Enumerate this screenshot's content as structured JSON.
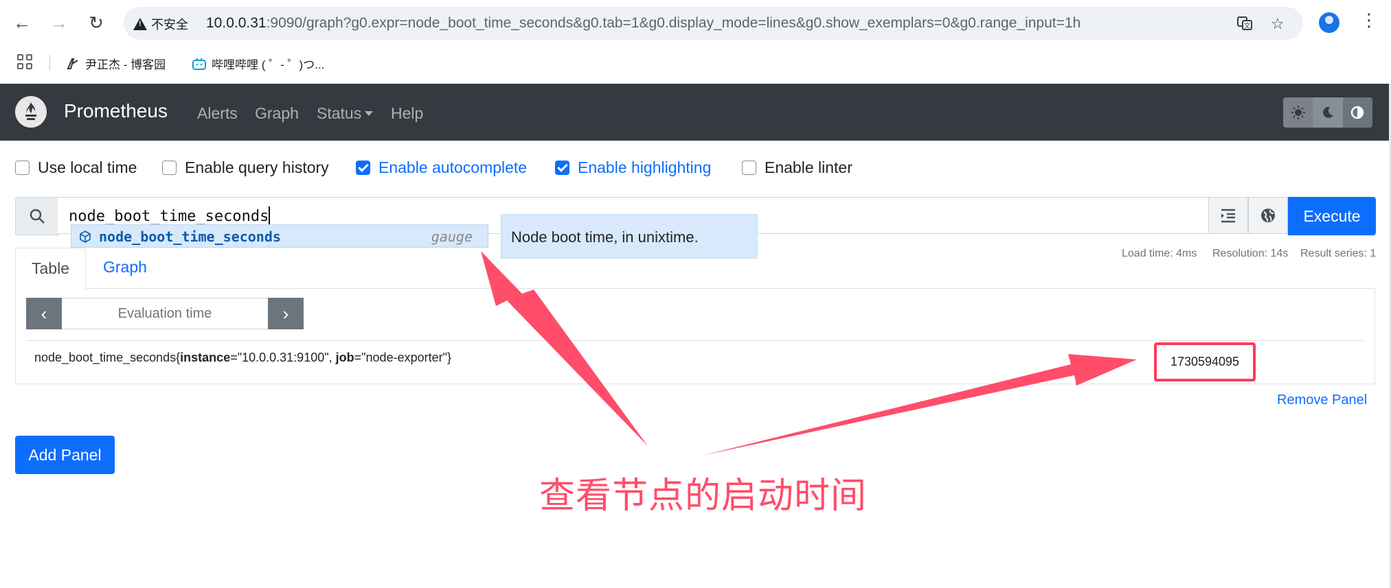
{
  "browser": {
    "security_label": "不安全",
    "url_host": "10.0.0.31",
    "url_rest": ":9090/graph?g0.expr=node_boot_time_seconds&g0.tab=1&g0.display_mode=lines&g0.show_exemplars=0&g0.range_input=1h",
    "bookmarks": [
      {
        "label": "尹正杰 - 博客园",
        "icon": "blog-icon"
      },
      {
        "label": "哔哩哔哩 ( ゜- ゜)つ...",
        "icon": "bilibili-icon"
      }
    ]
  },
  "navbar": {
    "brand": "Prometheus",
    "links": {
      "alerts": "Alerts",
      "graph": "Graph",
      "status": "Status",
      "help": "Help"
    }
  },
  "options": {
    "local_time": {
      "label": "Use local time",
      "checked": false
    },
    "query_history": {
      "label": "Enable query history",
      "checked": false
    },
    "autocomplete": {
      "label": "Enable autocomplete",
      "checked": true
    },
    "highlighting": {
      "label": "Enable highlighting",
      "checked": true
    },
    "linter": {
      "label": "Enable linter",
      "checked": false
    }
  },
  "query": {
    "expression": "node_boot_time_seconds",
    "execute_label": "Execute"
  },
  "autocomplete": {
    "name": "node_boot_time_seconds",
    "type": "gauge",
    "info": "Node boot time, in unixtime."
  },
  "stats": {
    "load_time": "Load time: 4ms",
    "resolution": "Resolution: 14s",
    "result_series": "Result series: 1"
  },
  "tabs": {
    "table": "Table",
    "graph": "Graph"
  },
  "evaluation": {
    "placeholder": "Evaluation time"
  },
  "result": {
    "metric": "node_boot_time_seconds",
    "open_brace": "{",
    "label1_key": "instance",
    "label1_eq": "=",
    "label1_val": "\"10.0.0.31:9100\"",
    "sep": ", ",
    "label2_key": "job",
    "label2_eq": "=",
    "label2_val": "\"node-exporter\"",
    "close_brace": "}",
    "value": "1730594095"
  },
  "panel": {
    "remove_label": "Remove Panel",
    "add_label": "Add Panel"
  },
  "annotation": {
    "caption": "查看节点的启动时间",
    "color": "#ff4d6a"
  },
  "colors": {
    "navbar_bg": "#343a40",
    "primary": "#0d6efd",
    "highlight_border": "#ff3b59"
  }
}
